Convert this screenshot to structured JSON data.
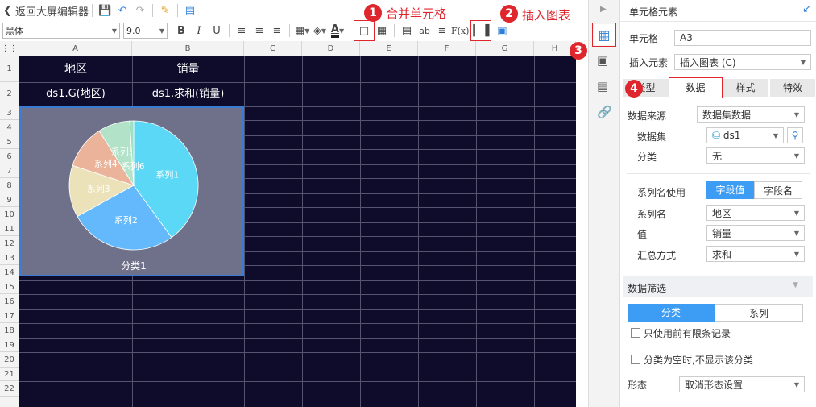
{
  "toolbar": {
    "back_label": "返回大屏编辑器",
    "font": "黑体",
    "font_size": "9.0",
    "bold": "B",
    "italic": "I",
    "underline": "U",
    "text_color_glyph": "A",
    "text_tool": "ab",
    "formula": "F(x)"
  },
  "callouts": {
    "c1": {
      "num": "1",
      "text": "合并单元格"
    },
    "c2": {
      "num": "2",
      "text": "插入图表"
    },
    "c3": {
      "num": "3"
    },
    "c4": {
      "num": "4"
    }
  },
  "grid": {
    "columns": [
      "A",
      "B",
      "C",
      "D",
      "E",
      "F",
      "G",
      "H"
    ],
    "rows": [
      "1",
      "2",
      "3",
      "4",
      "5",
      "6",
      "7",
      "8",
      "9",
      "10",
      "11",
      "12",
      "13",
      "14",
      "15",
      "16",
      "17",
      "18",
      "19",
      "20",
      "21",
      "22"
    ],
    "a1": "地区",
    "b1": "销量",
    "a2": "ds1.G(地区)",
    "b2": "ds1.求和(销量)"
  },
  "chart_data": {
    "type": "pie",
    "series": [
      {
        "name": "系列1",
        "value": 40
      },
      {
        "name": "系列2",
        "value": 27
      },
      {
        "name": "系列3",
        "value": 13
      },
      {
        "name": "系列4",
        "value": 11
      },
      {
        "name": "系列5",
        "value": 8
      },
      {
        "name": "系列6",
        "value": 1
      }
    ],
    "colors": [
      "#5ad8f5",
      "#63b9fb",
      "#ebe2ba",
      "#ebb49a",
      "#b2e2c7",
      "#9de0c4"
    ],
    "category_label": "分类1"
  },
  "panel": {
    "title": "单元格元素",
    "cell_label": "单元格",
    "cell_value": "A3",
    "insert_label": "插入元素",
    "insert_value": "插入图表 (C)",
    "tabs": [
      "类型",
      "数据",
      "样式",
      "特效"
    ],
    "source_label": "数据来源",
    "source_value": "数据集数据",
    "dataset_label": "数据集",
    "dataset_value": "ds1",
    "category_label": "分类",
    "category_value": "无",
    "series_use_label": "系列名使用",
    "series_use_options": [
      "字段值",
      "字段名"
    ],
    "series_name_label": "系列名",
    "series_name_value": "地区",
    "value_label": "值",
    "value_value": "销量",
    "agg_label": "汇总方式",
    "agg_value": "求和",
    "filter_title": "数据筛选",
    "filter_tabs": [
      "分类",
      "系列"
    ],
    "check1": "只使用前有限条记录",
    "check2": "分类为空时,不显示该分类",
    "shape_label": "形态",
    "shape_value": "取消形态设置"
  }
}
